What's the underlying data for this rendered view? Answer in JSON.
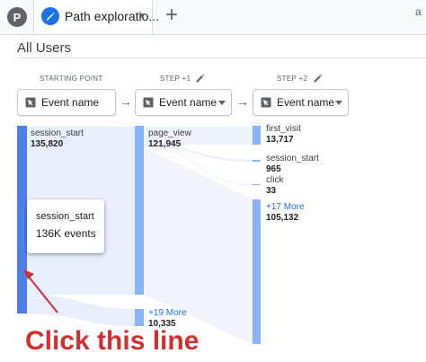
{
  "tabbar": {
    "avatar_letter": "P",
    "tab_label": "Path exploratio...",
    "add_tab_symbol": "+",
    "corner_letter": "a"
  },
  "segment": {
    "title": "All Users"
  },
  "columns": [
    {
      "header": "STARTING POINT",
      "dropdown_label": "Event name",
      "editable": false
    },
    {
      "header": "STEP +1",
      "dropdown_label": "Event name",
      "editable": true
    },
    {
      "header": "STEP +2",
      "dropdown_label": "Event name",
      "editable": true
    }
  ],
  "nodes": {
    "start": {
      "label": "session_start",
      "value": "135,820"
    },
    "step1_main": {
      "label": "page_view",
      "value": "121,945"
    },
    "step1_more": {
      "label": "+19 More",
      "value": "10,335"
    },
    "step2": [
      {
        "label": "first_visit",
        "value": "13,717"
      },
      {
        "label": "session_start",
        "value": "965"
      },
      {
        "label": "click",
        "value": "33"
      },
      {
        "label": "+17 More",
        "value": "105,132"
      }
    ]
  },
  "tooltip": {
    "name": "session_start",
    "value": "136K events"
  },
  "annotation": {
    "text": "Click this line"
  },
  "colors": {
    "node_start": "#4e7fe8",
    "node_step": "#8ab4f8",
    "flow": "#e8eefc",
    "annotation": "#d32f2f",
    "accent": "#1a73e8"
  }
}
